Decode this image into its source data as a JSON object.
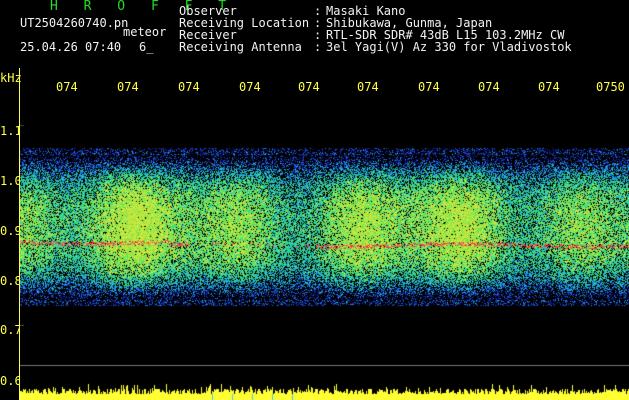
{
  "header": {
    "title": "H R O F F T",
    "filename": "UT2504260740.pn",
    "kind": "meteor",
    "date": "25.04.26 07:40",
    "count": "6_"
  },
  "info": [
    {
      "label": "Observer",
      "value": "Masaki Kano"
    },
    {
      "label": "Receiving Location",
      "value": "Shibukawa, Gunma, Japan"
    },
    {
      "label": "Receiver",
      "value": "RTL-SDR SDR# 43dB L15 103.2MHz CW"
    },
    {
      "label": "Receiving Antenna",
      "value": "3el Yagi(V) Az 330 for Vladivostok"
    }
  ],
  "axis": {
    "unit": "kHz",
    "y_ticks": [
      "1.1",
      "1.0",
      "0.9",
      "0.8",
      "0.7",
      "0.6"
    ],
    "x_ticks": [
      "074",
      "074",
      "074",
      "074",
      "074",
      "074",
      "074",
      "074",
      "074",
      "0750"
    ]
  },
  "colors": {
    "text": "#f2f2f2",
    "title": "#22dd22",
    "axis": "#ffff44",
    "band_core": "#22cc88",
    "band_edge": "#1a2ad8",
    "trace": "#ff3344",
    "power_bar": "#ffff33"
  },
  "chart_data": {
    "type": "heatmap",
    "y_axis_khz": [
      0.6,
      1.1
    ],
    "noise_band_khz": [
      0.75,
      1.04
    ],
    "carrier_trace_khz": 0.86
  }
}
